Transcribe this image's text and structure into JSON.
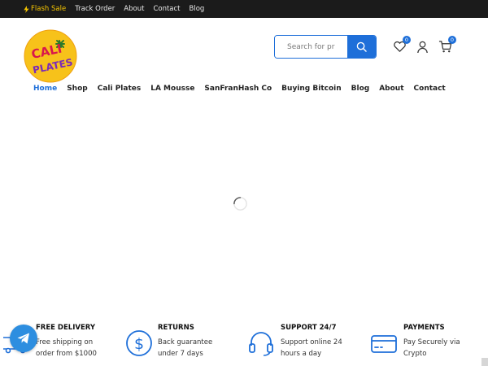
{
  "topbar": {
    "flash_sale": "Flash Sale",
    "track_order": "Track Order",
    "about": "About",
    "contact": "Contact",
    "blog": "Blog"
  },
  "logo": {
    "line1": "CALI",
    "line2": "PLATES"
  },
  "search": {
    "placeholder": "Search for pr"
  },
  "header_icons": {
    "wishlist_count": "0",
    "cart_count": "0"
  },
  "nav": {
    "items": [
      "Home",
      "Shop",
      "Cali Plates",
      "LA Mousse",
      "SanFranHash Co",
      "Buying Bitcoin",
      "Blog",
      "About",
      "Contact"
    ],
    "active": "Home"
  },
  "features": [
    {
      "title": "FREE DELIVERY",
      "desc": "Free shipping on order from $1000",
      "icon": "truck-icon"
    },
    {
      "title": "RETURNS",
      "desc": "Back guarantee under 7 days",
      "icon": "dollar-coin-icon"
    },
    {
      "title": "SUPPORT 24/7",
      "desc": "Support online 24 hours a day",
      "icon": "headset-icon"
    },
    {
      "title": "PAYMENTS",
      "desc": "Pay Securely via Crypto",
      "icon": "credit-card-icon"
    }
  ],
  "colors": {
    "accent": "#1e6fd9",
    "topbar_bg": "#1b1b1b",
    "flash": "#f5c400",
    "telegram": "#2d8ee0"
  }
}
